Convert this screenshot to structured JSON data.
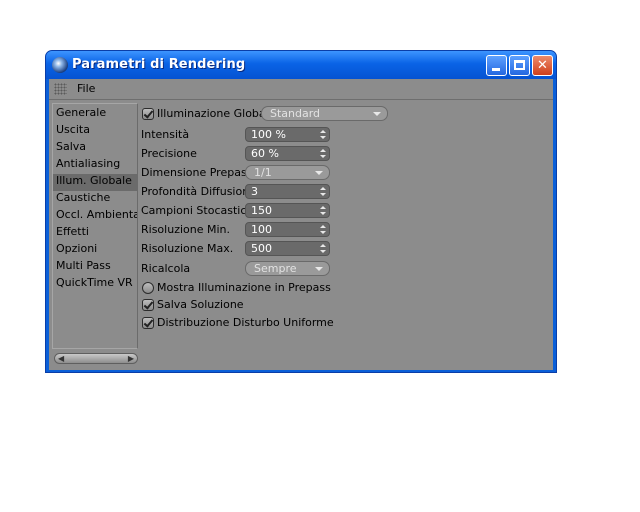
{
  "window": {
    "title": "Parametri di Rendering"
  },
  "menu": {
    "file_label": "File"
  },
  "sidebar": {
    "items": [
      {
        "label": "Generale"
      },
      {
        "label": "Uscita"
      },
      {
        "label": "Salva"
      },
      {
        "label": "Antialiasing"
      },
      {
        "label": "Illum. Globale"
      },
      {
        "label": "Caustiche"
      },
      {
        "label": "Occl. Ambientale"
      },
      {
        "label": "Effetti"
      },
      {
        "label": "Opzioni"
      },
      {
        "label": "Multi Pass"
      },
      {
        "label": "QuickTime VR"
      }
    ],
    "selected": "Illum. Globale"
  },
  "gi": {
    "enable_label": "Illuminazione Globale",
    "enable_checked": true,
    "mode_value": "Standard",
    "fields": {
      "intensita": {
        "label": "Intensità",
        "value": "100 %"
      },
      "precisione": {
        "label": "Precisione",
        "value": "60 %"
      },
      "dim_prepass": {
        "label": "Dimensione Prepass",
        "value": "1/1"
      },
      "prof_diffusione": {
        "label": "Profondità Diffusione",
        "value": "3"
      },
      "campioni": {
        "label": "Campioni Stocastici",
        "value": "150"
      },
      "ris_min": {
        "label": "Risoluzione Min.",
        "value": "100"
      },
      "ris_max": {
        "label": "Risoluzione Max.",
        "value": "500"
      },
      "ricalcola": {
        "label": "Ricalcola",
        "value": "Sempre"
      }
    },
    "checkboxes": {
      "mostra": {
        "label": "Mostra Illuminazione in Prepass",
        "checked": false
      },
      "salva": {
        "label": "Salva Soluzione",
        "checked": true
      },
      "distribuzione": {
        "label": "Distribuzione Disturbo Uniforme",
        "checked": true
      }
    }
  }
}
